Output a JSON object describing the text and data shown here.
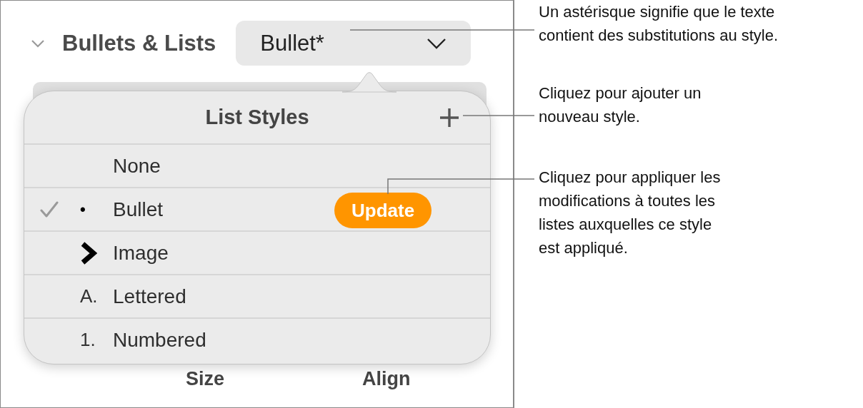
{
  "section": {
    "title": "Bullets & Lists",
    "expanded": true,
    "style_popup": {
      "value": "Bullet*"
    }
  },
  "popover": {
    "title": "List Styles",
    "rows": [
      {
        "kind": "none",
        "label": "None",
        "checked": false
      },
      {
        "kind": "bullet",
        "marker": "•",
        "label": "Bullet",
        "checked": true,
        "update_button": "Update"
      },
      {
        "kind": "image",
        "label": "Image",
        "checked": false
      },
      {
        "kind": "lettered",
        "marker": "A.",
        "label": "Lettered",
        "checked": false
      },
      {
        "kind": "numbered",
        "marker": "1.",
        "label": "Numbered",
        "checked": false
      }
    ]
  },
  "footer_labels": [
    "Size",
    "Align"
  ],
  "callouts": [
    {
      "lines": [
        "Un astérisque signifie que le texte",
        "contient des substitutions au style."
      ]
    },
    {
      "lines": [
        "Cliquez pour ajouter un",
        "nouveau style."
      ]
    },
    {
      "lines": [
        "Cliquez pour appliquer les",
        "modifications à toutes les",
        "listes auxquelles ce style",
        "est appliqué."
      ]
    }
  ]
}
